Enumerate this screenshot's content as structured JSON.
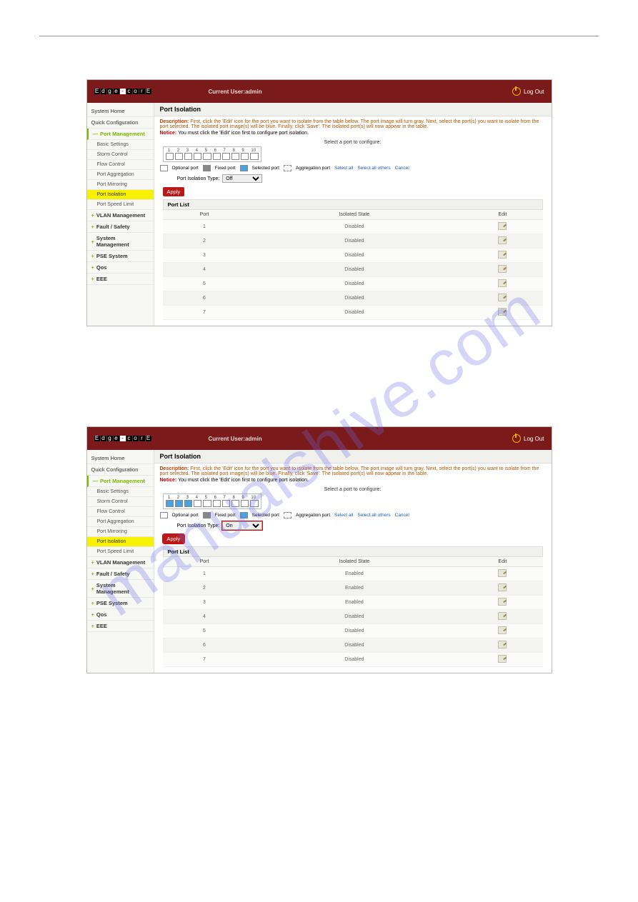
{
  "watermark": "manualshive.com",
  "header": {
    "logo_text": "Edge-corE",
    "current_user_label": "Current User:admin",
    "logout_label": "Log Out"
  },
  "sidebar": {
    "items": [
      {
        "label": "System Home",
        "type": "top"
      },
      {
        "label": "Quick Configuration",
        "type": "top"
      },
      {
        "label": "Port Management",
        "type": "parent-open"
      },
      {
        "label": "Basic Settings",
        "type": "child"
      },
      {
        "label": "Storm Control",
        "type": "child"
      },
      {
        "label": "Flow Control",
        "type": "child"
      },
      {
        "label": "Port Aggregation",
        "type": "child"
      },
      {
        "label": "Port Mirroring",
        "type": "child"
      },
      {
        "label": "Port Isolation",
        "type": "child-active"
      },
      {
        "label": "Port Speed Limit",
        "type": "child"
      },
      {
        "label": "VLAN Management",
        "type": "parent"
      },
      {
        "label": "Fault / Safety",
        "type": "parent"
      },
      {
        "label": "System Management",
        "type": "parent"
      },
      {
        "label": "PSE System",
        "type": "parent"
      },
      {
        "label": "Qos",
        "type": "parent"
      },
      {
        "label": "EEE",
        "type": "parent"
      }
    ]
  },
  "panel": {
    "title": "Port Isolation",
    "description_label": "Description:",
    "description_text": "First, click the 'Edit' icon for the port you want to isolate from the table below. The port image will turn gray. Next, select the port(s) you want to isolate from the port selected. The isolated port image(s) will be blue. Finally, click 'Save'. The isolated port(s) will now appear in the table.",
    "notice_label": "Notice:",
    "notice_text": "You must click the 'Edit' icon first to configure port isolation.",
    "select_port_label": "Select a port to configure:",
    "port_numbers": [
      "1",
      "2",
      "3",
      "4",
      "5",
      "6",
      "7",
      "8",
      "9",
      "10"
    ],
    "legend": {
      "optional": "Optional port",
      "fixed": "Fixed port",
      "selected": "Selected port",
      "aggregation": "Aggregation port",
      "select_all": "Select all",
      "select_others": "Select all others",
      "cancel": "Cancel"
    },
    "isolation_type_label": "Port Isolation Type:",
    "apply_label": "Apply",
    "port_list_label": "Port List",
    "table_headers": {
      "port": "Port",
      "state": "Isolated State",
      "edit": "Edit"
    }
  },
  "screenshot1": {
    "isolation_type_value": "Off",
    "selected_ports": [],
    "rows": [
      {
        "port": "1",
        "state": "Disabled"
      },
      {
        "port": "2",
        "state": "Disabled"
      },
      {
        "port": "3",
        "state": "Disabled"
      },
      {
        "port": "4",
        "state": "Disabled"
      },
      {
        "port": "5",
        "state": "Disabled"
      },
      {
        "port": "6",
        "state": "Disabled"
      },
      {
        "port": "7",
        "state": "Disabled"
      }
    ]
  },
  "screenshot2": {
    "isolation_type_value": "On",
    "selected_ports": [
      1,
      2,
      3
    ],
    "rows": [
      {
        "port": "1",
        "state": "Enabled"
      },
      {
        "port": "2",
        "state": "Enabled"
      },
      {
        "port": "3",
        "state": "Enabled"
      },
      {
        "port": "4",
        "state": "Disabled"
      },
      {
        "port": "5",
        "state": "Disabled"
      },
      {
        "port": "6",
        "state": "Disabled"
      },
      {
        "port": "7",
        "state": "Disabled"
      }
    ]
  }
}
